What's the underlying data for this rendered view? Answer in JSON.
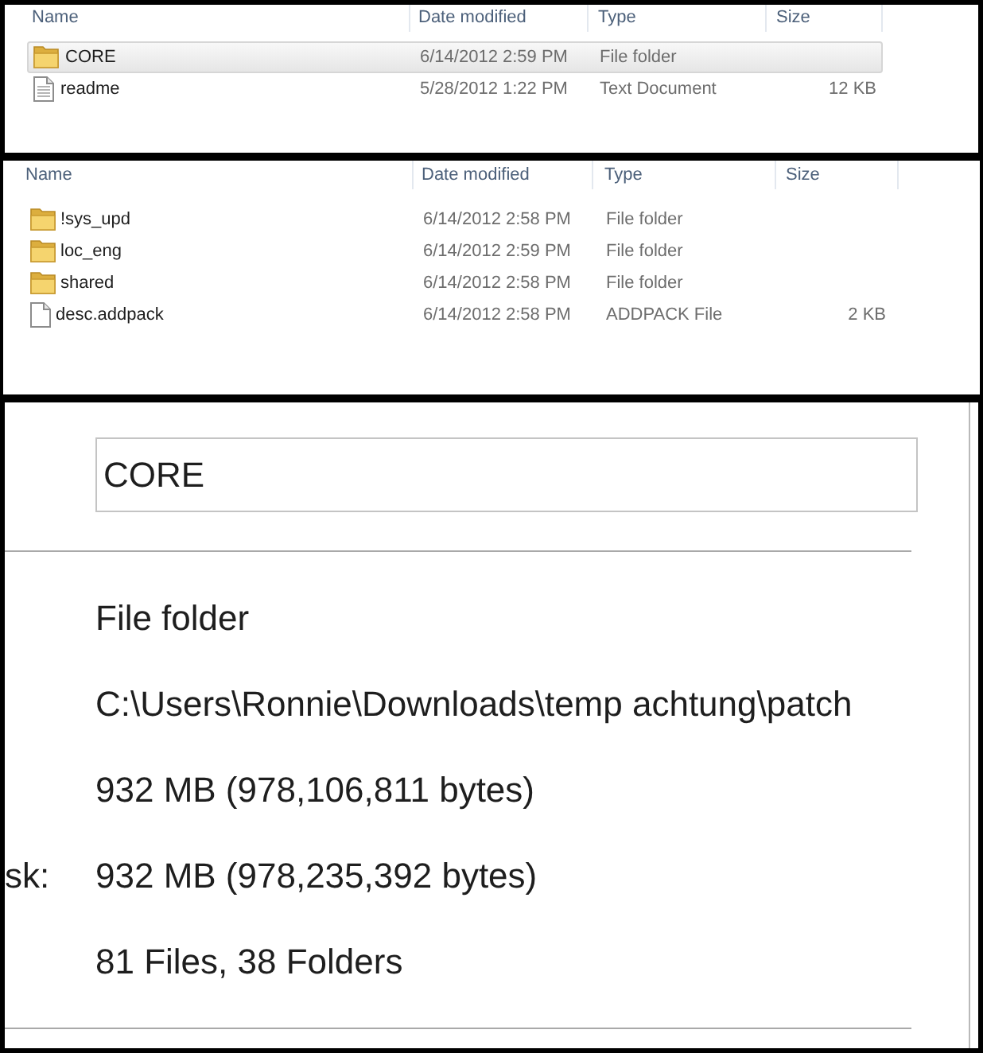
{
  "explorer_views": [
    {
      "columns": [
        "Name",
        "Date modified",
        "Type",
        "Size"
      ],
      "rows": [
        {
          "kind": "folder",
          "name": "CORE",
          "date_modified": "6/14/2012 2:59 PM",
          "type": "File folder",
          "selected": true
        },
        {
          "kind": "text",
          "name": "readme",
          "date_modified": "5/28/2012 1:22 PM",
          "type": "Text Document",
          "size": "12 KB",
          "selected": false
        }
      ]
    },
    {
      "columns": [
        "Name",
        "Date modified",
        "Type",
        "Size"
      ],
      "rows": [
        {
          "kind": "folder",
          "name": "!sys_upd",
          "date_modified": "6/14/2012 2:58 PM",
          "type": "File folder",
          "selected": false
        },
        {
          "kind": "folder",
          "name": "loc_eng",
          "date_modified": "6/14/2012 2:59 PM",
          "type": "File folder",
          "selected": false
        },
        {
          "kind": "folder",
          "name": "shared",
          "date_modified": "6/14/2012 2:58 PM",
          "type": "File folder",
          "selected": false
        },
        {
          "kind": "file",
          "name": "desc.addpack",
          "date_modified": "6/14/2012 2:58 PM",
          "type": "ADDPACK File",
          "size": "2 KB",
          "selected": false
        }
      ]
    }
  ],
  "properties": {
    "name_field": {
      "value": "CORE"
    },
    "rows": [
      {
        "value": "File folder"
      },
      {
        "value": "C:\\Users\\Ronnie\\Downloads\\temp achtung\\patch"
      },
      {
        "value": "932 MB (978,106,811 bytes)"
      },
      {
        "label": "sk:",
        "value": "932 MB (978,235,392 bytes)"
      },
      {
        "value": "81 Files, 38 Folders"
      }
    ]
  }
}
